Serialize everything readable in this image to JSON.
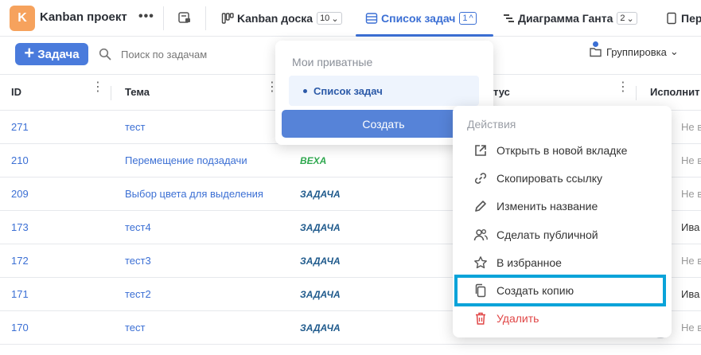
{
  "project": {
    "avatar_letter": "K",
    "name": "Kanban проект",
    "more": "•••"
  },
  "tabs": [
    {
      "label": "Kanban доска",
      "count": "10",
      "chevron": "⌄"
    },
    {
      "label": "Список задач",
      "count": "1",
      "chevron": "^"
    },
    {
      "label": "Диаграмма Ганта",
      "count": "2",
      "chevron": "⌄"
    },
    {
      "label": "Пер"
    }
  ],
  "toolbar": {
    "add_label": "Задача",
    "add_icon": "+",
    "search_placeholder": "Поиск по задачам",
    "group_label": "Группировка",
    "group_chevron": "⌄"
  },
  "table": {
    "columns": {
      "id": "ID",
      "topic": "Тема",
      "status": "тус",
      "assignee": "Исполнит"
    },
    "rows": [
      {
        "id": "271",
        "topic": "тест",
        "type": "",
        "assignee": "Не в"
      },
      {
        "id": "210",
        "topic": "Перемещение подзадачи",
        "type": "ВЕХА",
        "assignee": "Не в"
      },
      {
        "id": "209",
        "topic": "Выбор цвета для выделения",
        "type": "ЗАДАЧА",
        "assignee": "Не в"
      },
      {
        "id": "173",
        "topic": "тест4",
        "type": "ЗАДАЧА",
        "assignee": "Ива"
      },
      {
        "id": "172",
        "topic": "тест3",
        "type": "ЗАДАЧА",
        "assignee": "Не в"
      },
      {
        "id": "171",
        "topic": "тест2",
        "type": "ЗАДАЧА",
        "assignee": "Ива"
      },
      {
        "id": "170",
        "topic": "тест",
        "type": "ЗАДАЧА",
        "assignee": "Не в"
      }
    ]
  },
  "views_popup": {
    "heading": "Мои приватные",
    "item": "Список задач",
    "create_label": "Создать"
  },
  "actions_menu": {
    "heading": "Действия",
    "items": [
      {
        "label": "Открыть в новой вкладке",
        "icon": "external-link-icon"
      },
      {
        "label": "Скопировать ссылку",
        "icon": "link-icon"
      },
      {
        "label": "Изменить название",
        "icon": "pencil-icon"
      },
      {
        "label": "Сделать публичной",
        "icon": "users-icon"
      },
      {
        "label": "В избранное",
        "icon": "star-icon"
      },
      {
        "label": "Создать копию",
        "icon": "copy-icon"
      },
      {
        "label": "Удалить",
        "icon": "trash-icon"
      }
    ]
  },
  "colors": {
    "accent": "#3b6fd4",
    "milestone": "#2fa84f",
    "task": "#1f5a8c",
    "danger": "#e04646",
    "highlight": "#0aa3d9"
  }
}
